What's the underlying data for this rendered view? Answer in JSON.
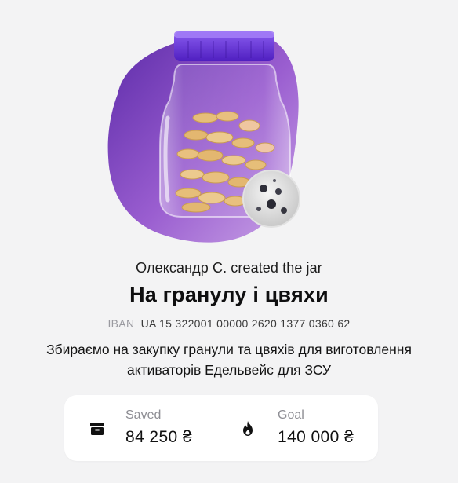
{
  "jar": {
    "creator_line": "Олександр С. created the jar",
    "title": "На гранулу і цвяхи",
    "iban_label": "IBAN",
    "iban_number": "UA 15 322001 00000 2620 1377 0360 62",
    "description": "Збираємо на закупку гранули та цвяхів для виготовлення активаторів Едельвейс для ЗСУ"
  },
  "stats": {
    "saved": {
      "label": "Saved",
      "value": "84 250 ₴",
      "icon": "archive-box-icon"
    },
    "goal": {
      "label": "Goal",
      "value": "140 000 ₴",
      "icon": "flame-icon"
    }
  },
  "progress": {
    "saved_fraction": 0.6
  },
  "colors": {
    "background": "#f3f3f4",
    "blob_purple": "#9b5fc7",
    "lid_purple": "#6a34d6",
    "coin_gold": "#e6be79",
    "card": "#ffffff"
  }
}
